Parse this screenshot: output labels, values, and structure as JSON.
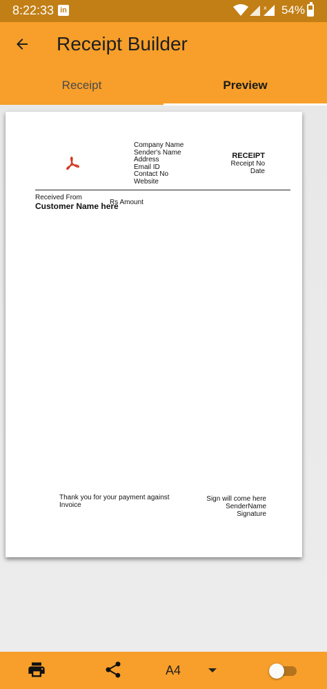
{
  "status_bar": {
    "time": "8:22:33",
    "linkedin_label": "in",
    "battery": "54%",
    "icons": [
      "linkedin-icon",
      "wifi-icon",
      "signal-icon",
      "signal-icon",
      "battery-icon"
    ]
  },
  "app_bar": {
    "title": "Receipt Builder",
    "back_icon": "arrow-back-icon"
  },
  "tabs": [
    {
      "label": "Receipt",
      "selected": false
    },
    {
      "label": "Preview",
      "selected": true
    }
  ],
  "receipt": {
    "logo_icon": "pdf-icon",
    "company": {
      "name": "Company Name",
      "sender": "Sender's Name",
      "address": "Address",
      "email": "Email ID",
      "contact": "Contact No",
      "website": "Website"
    },
    "title": "RECEIPT",
    "receipt_no_label": "Receipt No",
    "date_label": "Date",
    "received_from_label": "Received From",
    "customer_name": "Customer Name here",
    "amount": "Rs Amount",
    "thanks": "Thank you for your payment against Invoice",
    "sign_note": "Sign will come here",
    "sender_name": "SenderName",
    "signature_label": "Signature"
  },
  "bottom_bar": {
    "print_icon": "print-icon",
    "share_icon": "share-icon",
    "page_size": "A4",
    "dropdown_icon": "dropdown-arrow-icon",
    "toggle_on": false
  },
  "colors": {
    "accent": "#f79f2a",
    "status_bar": "#c27f16"
  }
}
